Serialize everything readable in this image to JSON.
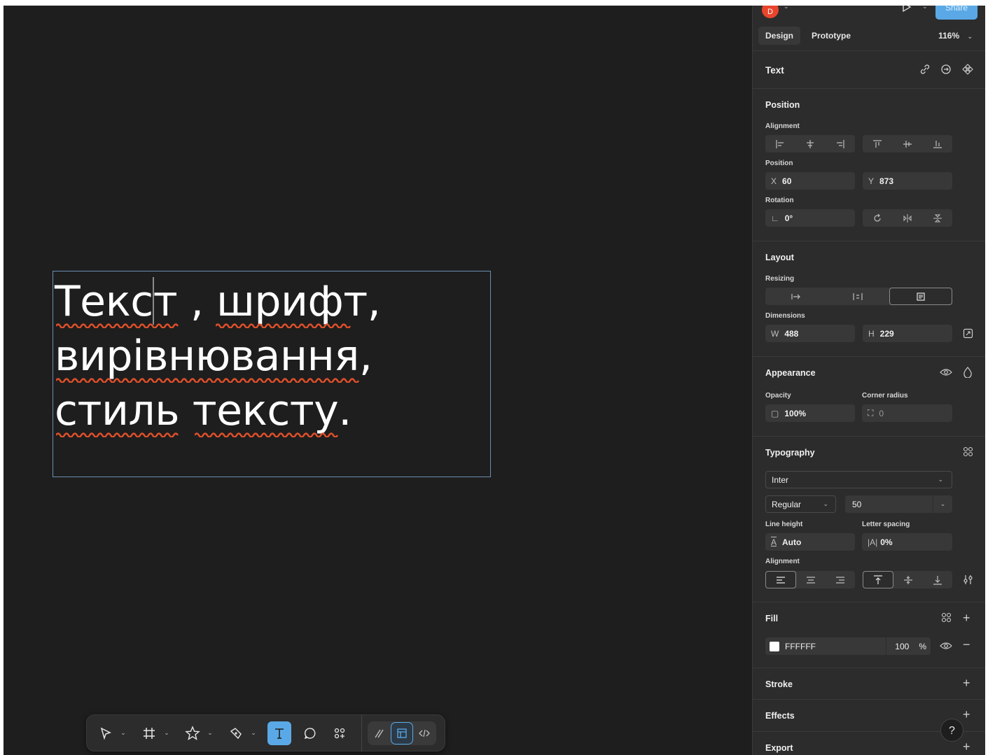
{
  "canvas": {
    "text_lines": [
      "Текст , шрифт,",
      "вирівнювання,",
      "стиль тексту."
    ]
  },
  "header": {
    "avatar_letter": "D",
    "share_label": "Share",
    "tabs": [
      "Design",
      "Prototype"
    ],
    "zoom": "116%"
  },
  "layer": {
    "title": "Text"
  },
  "position": {
    "title": "Position",
    "alignment_label": "Alignment",
    "position_label": "Position",
    "x_prefix": "X",
    "x": "60",
    "y_prefix": "Y",
    "y": "873",
    "rotation_label": "Rotation",
    "rotation": "0°"
  },
  "layout": {
    "title": "Layout",
    "resizing_label": "Resizing",
    "dimensions_label": "Dimensions",
    "w_prefix": "W",
    "w": "488",
    "h_prefix": "H",
    "h": "229"
  },
  "appearance": {
    "title": "Appearance",
    "opacity_label": "Opacity",
    "opacity": "100%",
    "corner_label": "Corner radius",
    "corner": "0"
  },
  "typography": {
    "title": "Typography",
    "font_family": "Inter",
    "font_style": "Regular",
    "font_size": "50",
    "line_height_label": "Line height",
    "line_height": "Auto",
    "letter_spacing_label": "Letter spacing",
    "letter_spacing": "0%",
    "alignment_label": "Alignment"
  },
  "fill": {
    "title": "Fill",
    "hex": "FFFFFF",
    "opacity": "100",
    "pct": "%"
  },
  "stroke": {
    "title": "Stroke"
  },
  "effects": {
    "title": "Effects"
  },
  "export": {
    "title": "Export"
  },
  "help": "?",
  "colors": {
    "canvas_bg": "#1e1e1e",
    "panel_bg": "#2c2c2c",
    "accent": "#5aa9e6",
    "spell_error": "#e0502a",
    "avatar": "#e8452c"
  }
}
